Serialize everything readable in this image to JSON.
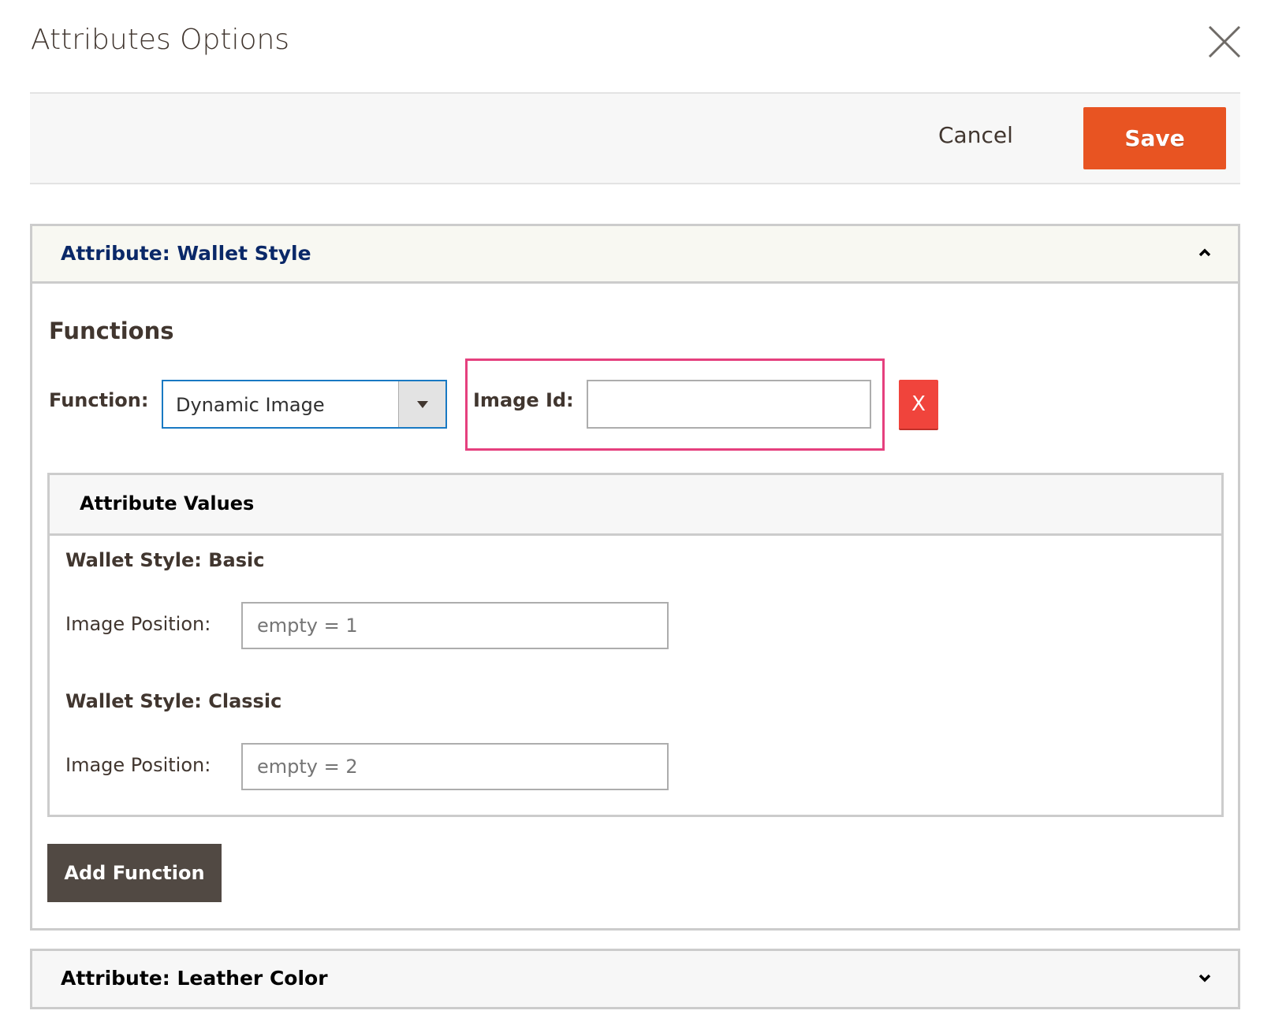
{
  "modal": {
    "title": "Attributes Options",
    "close_icon": "close-icon"
  },
  "toolbar": {
    "cancel_label": "Cancel",
    "save_label": "Save"
  },
  "colors": {
    "save": "#e85422",
    "delete": "#f0443c",
    "highlight": "#e5407e",
    "panel_title": "#0a2868",
    "add_function": "#514943"
  },
  "sections": [
    {
      "title": "Attribute: Wallet Style",
      "expanded": true,
      "functions_heading": "Functions",
      "function_label": "Function:",
      "function_value": "Dynamic Image",
      "image_id_label": "Image Id:",
      "image_id_value": "",
      "delete_label": "X",
      "attribute_values": {
        "heading": "Attribute Values",
        "items": [
          {
            "title": "Wallet Style: Basic",
            "label": "Image Position:",
            "placeholder": "empty = 1"
          },
          {
            "title": "Wallet Style: Classic",
            "label": "Image Position:",
            "placeholder": "empty = 2"
          }
        ]
      },
      "add_function_label": "Add Function"
    },
    {
      "title": "Attribute: Leather Color",
      "expanded": false
    }
  ]
}
